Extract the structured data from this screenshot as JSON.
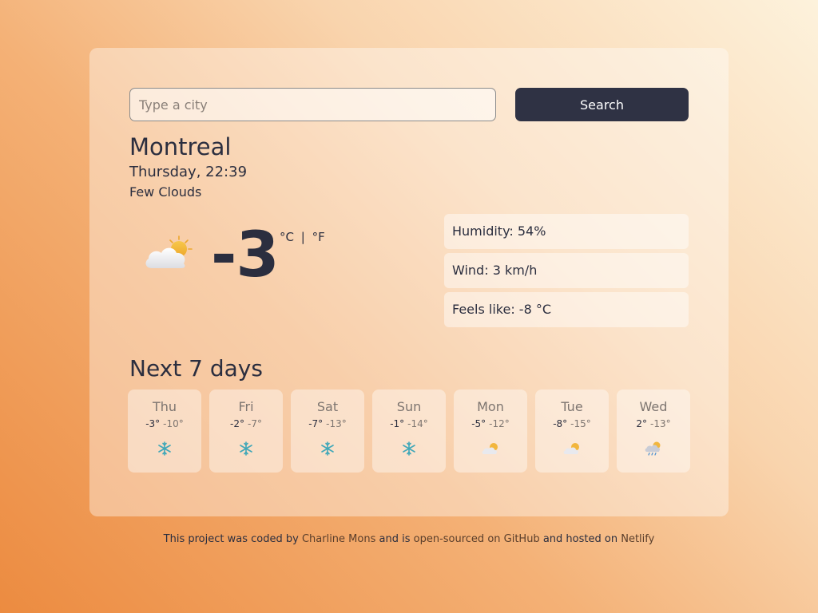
{
  "search": {
    "placeholder": "Type a city",
    "value": "",
    "button_label": "Search"
  },
  "current": {
    "city": "Montreal",
    "datetime": "Thursday, 22:39",
    "description": "Few Clouds",
    "icon": "partly-cloudy-night-icon",
    "temperature": "-3",
    "unit_celsius": "°C",
    "unit_separator": "|",
    "unit_fahrenheit": "°F"
  },
  "stats": {
    "humidity": "Humidity: 54%",
    "wind": "Wind: 3 km/h",
    "feels_like": "Feels like: -8 °C"
  },
  "forecast": {
    "title": "Next 7 days",
    "days": [
      {
        "name": "Thu",
        "max": "-3°",
        "min": "-10°",
        "icon": "snowflake-icon"
      },
      {
        "name": "Fri",
        "max": "-2°",
        "min": "-7°",
        "icon": "snowflake-icon"
      },
      {
        "name": "Sat",
        "max": "-7°",
        "min": "-13°",
        "icon": "snowflake-icon"
      },
      {
        "name": "Sun",
        "max": "-1°",
        "min": "-14°",
        "icon": "snowflake-icon"
      },
      {
        "name": "Mon",
        "max": "-5°",
        "min": "-12°",
        "icon": "partly-cloudy-icon"
      },
      {
        "name": "Tue",
        "max": "-8°",
        "min": "-15°",
        "icon": "partly-cloudy-icon"
      },
      {
        "name": "Wed",
        "max": "2°",
        "min": "-13°",
        "icon": "rain-sun-icon"
      }
    ]
  },
  "footer": {
    "text_1": "This project was coded by",
    "author_link": "Charline Mons",
    "text_2": "and is",
    "source_link": "open-sourced on GitHub",
    "text_3": "and hosted on",
    "host_link": "Netlify"
  },
  "colors": {
    "text": "#2b2e3f",
    "button": "#2f3244",
    "muted": "#7d7570"
  }
}
